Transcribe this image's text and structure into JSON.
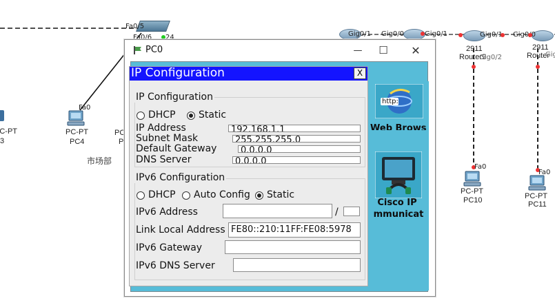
{
  "topology": {
    "labels": {
      "fa0_5": "Fa0/5",
      "fa0_6": "Fa0/6",
      "num24": "24",
      "fa0_pc4": "Fa0",
      "pcpt_left": "PC-PT",
      "num3": "3",
      "pc4_type": "PC-PT",
      "pc4_name": "PC4",
      "pc_partial": "PC",
      "pc_partial2": "P",
      "dept": "市场部",
      "gig0_1_a": "Gig0/1",
      "gig0_0_a": "Gig0/0",
      "gig0_1_b": "Gig0/1",
      "gig0_0_b": "Gig0/0",
      "gig0_1_c": "Gig0/1",
      "gig0_2": "Gig0/2",
      "router_2911_a": "2911",
      "router_name_a": "Router9",
      "router_2911_b": "2911",
      "router_name_b": "Router",
      "fa0_pc10": "Fa0",
      "pc10_type": "PC-PT",
      "pc10_name": "PC10",
      "fa0_pc11": "Fa0",
      "pc11_type": "PC-PT",
      "pc11_name": "PC11",
      "gig_partial": "Gig"
    }
  },
  "window": {
    "title": "PC0",
    "icons": {
      "app": "pc-flag-icon",
      "minimize": "minimize-icon",
      "maximize": "maximize-icon",
      "close": "close-icon"
    },
    "minimize": "—",
    "maximize": "☐",
    "close": "✕"
  },
  "apps": {
    "web_browser": {
      "caption": "Web Browser",
      "icon": "web-browser-icon",
      "badge": "http:"
    },
    "cisco_ip": {
      "caption_line1": "Cisco IP",
      "caption_line2": "mmunicat",
      "icon": "cisco-ip-communicator-icon"
    }
  },
  "ip_config": {
    "title": "IP Configuration",
    "close_label": "X",
    "ipv4": {
      "group_title": "IP Configuration",
      "dhcp_label": "DHCP",
      "static_label": "Static",
      "selected": "Static",
      "ip_address_label": "IP Address",
      "ip_address": "192.168.1.1",
      "subnet_mask_label": "Subnet Mask",
      "subnet_mask": "255.255.255.0",
      "gateway_label": "Default Gateway",
      "gateway": "0.0.0.0",
      "dns_label": "DNS Server",
      "dns": "0.0.0.0"
    },
    "ipv6": {
      "group_title": "IPv6 Configuration",
      "dhcp_label": "DHCP",
      "auto_label": "Auto Config",
      "static_label": "Static",
      "selected": "Static",
      "address_label": "IPv6 Address",
      "address": "",
      "prefix_sep": "/",
      "prefix": "",
      "link_local_label": "Link Local Address",
      "link_local": "FE80::210:11FF:FE08:5978",
      "gateway_label": "IPv6 Gateway",
      "gateway": "",
      "dns_label": "IPv6 DNS Server",
      "dns": ""
    }
  },
  "colors": {
    "title_blue": "#1414ff",
    "desktop_cyan": "#57bcd8",
    "link_black": "#111111",
    "link_red_dashed": "#cc2222",
    "port_dot_red": "#ee3333",
    "port_dot_green": "#22cc22"
  }
}
